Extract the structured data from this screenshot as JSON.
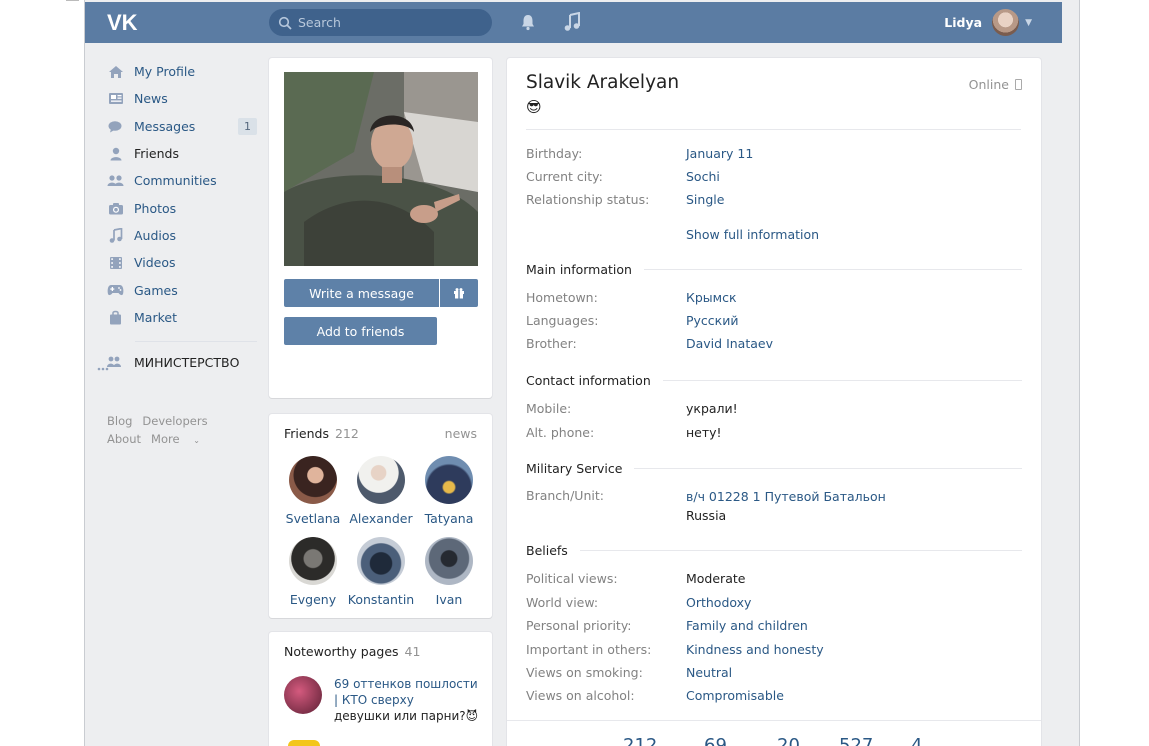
{
  "topbar": {
    "search_placeholder": "Search",
    "user_name": "Lidya"
  },
  "sidebar": {
    "items": [
      {
        "label": "My Profile",
        "icon": "home-icon"
      },
      {
        "label": "News",
        "icon": "news-icon"
      },
      {
        "label": "Messages",
        "icon": "messages-icon",
        "badge": "1"
      },
      {
        "label": "Friends",
        "icon": "friends-icon"
      },
      {
        "label": "Communities",
        "icon": "communities-icon"
      },
      {
        "label": "Photos",
        "icon": "camera-icon"
      },
      {
        "label": "Audios",
        "icon": "music-icon"
      },
      {
        "label": "Videos",
        "icon": "film-icon"
      },
      {
        "label": "Games",
        "icon": "gamepad-icon"
      },
      {
        "label": "Market",
        "icon": "bag-icon"
      }
    ],
    "group": "МИНИСТЕРСТВО",
    "footer": [
      "Blog",
      "Developers",
      "About",
      "More"
    ]
  },
  "photo_card": {
    "write_message": "Write a message",
    "add_to_friends": "Add to friends"
  },
  "friends": {
    "title": "Friends",
    "count": "212",
    "link": "news",
    "list": [
      "Svetlana",
      "Alexander",
      "Tatyana",
      "Evgeny",
      "Konstantin",
      "Ivan"
    ]
  },
  "noteworthy": {
    "title": "Noteworthy pages",
    "count": "41",
    "item_title": "69 оттенков пошлости | КТО сверху",
    "item_sub": "девушки или парни?😈"
  },
  "profile": {
    "name": "Slavik Arakelyan",
    "emoji": "😎",
    "status": "Online",
    "basic": [
      {
        "k": "Birthday:",
        "v": "January 11"
      },
      {
        "k": "Current city:",
        "v": "Sochi"
      },
      {
        "k": "Relationship status:",
        "v": "Single"
      }
    ],
    "show_full": "Show full information",
    "main_title": "Main information",
    "main": [
      {
        "k": "Hometown:",
        "v": "Крымск"
      },
      {
        "k": "Languages:",
        "v": "Русский"
      },
      {
        "k": "Brother:",
        "v": "David Inataev"
      }
    ],
    "contact_title": "Contact information",
    "contact": [
      {
        "k": "Mobile:",
        "v": "украли!"
      },
      {
        "k": "Alt. phone:",
        "v": "нету!"
      }
    ],
    "military_title": "Military Service",
    "military": {
      "k": "Branch/Unit:",
      "v": "в/ч 01228 1 Путевой Батальон",
      "v2": "Russia"
    },
    "beliefs_title": "Beliefs",
    "beliefs": [
      {
        "k": "Political views:",
        "v": "Moderate"
      },
      {
        "k": "World view:",
        "v": "Orthodoxy"
      },
      {
        "k": "Personal priority:",
        "v": "Family and children"
      },
      {
        "k": "Important in others:",
        "v": "Kindness and honesty"
      },
      {
        "k": "Views on smoking:",
        "v": "Neutral"
      },
      {
        "k": "Views on alcohol:",
        "v": "Compromisable"
      }
    ],
    "counters": [
      "212",
      "69",
      "20",
      "527",
      "4"
    ]
  },
  "colors": {
    "header": "#5b7ca3",
    "accent": "#2a5885",
    "button": "#5e81a8"
  }
}
